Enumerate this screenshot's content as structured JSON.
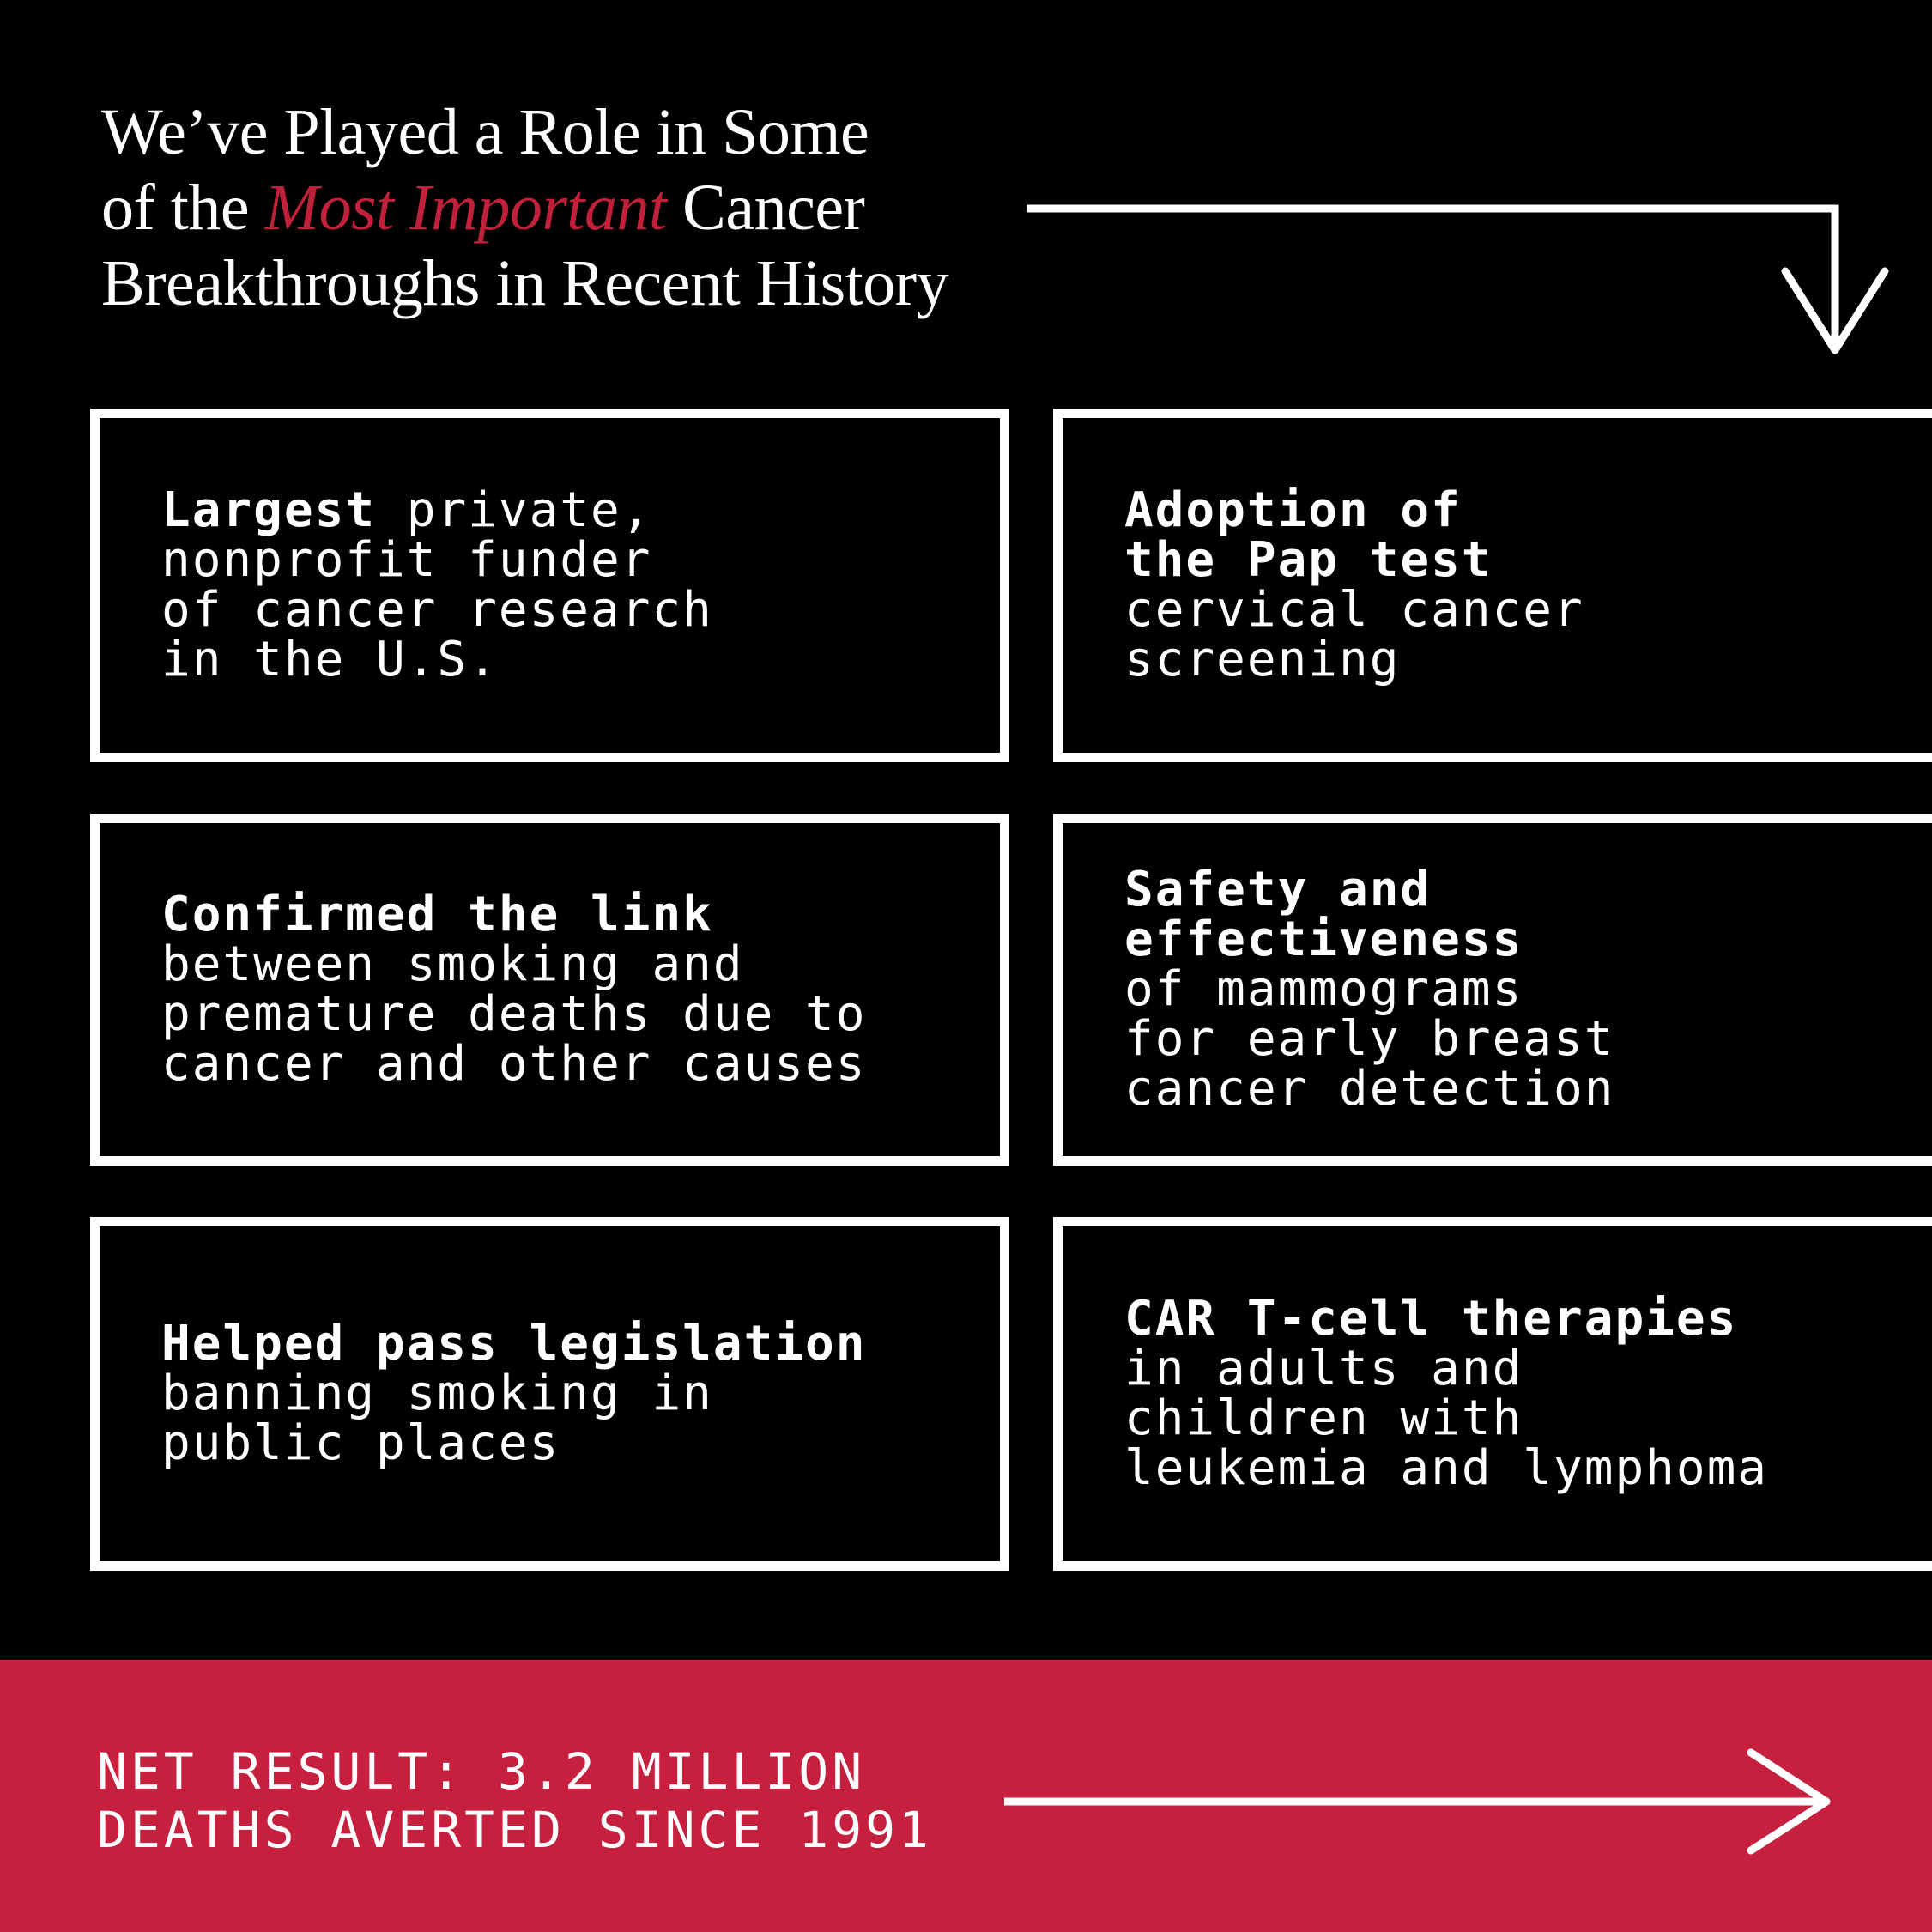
{
  "heading": {
    "line1": "We’ve Played a Role in Some",
    "line2_before": "of the ",
    "line2_accent": "Most Important",
    "line2_after": " Cancer",
    "line3": "Breakthroughs in Recent History"
  },
  "cards": [
    {
      "bold": [
        "Largest"
      ],
      "inline_light": " private,",
      "light": [
        "nonprofit funder",
        "of cancer research",
        "in the U.S."
      ]
    },
    {
      "bold": [
        "Adoption of",
        "the Pap test"
      ],
      "inline_light": "",
      "light": [
        "cervical cancer",
        "screening"
      ]
    },
    {
      "bold": [
        "Confirmed the link"
      ],
      "inline_light": "",
      "light": [
        "between smoking and",
        "premature deaths due to",
        "cancer and other causes"
      ]
    },
    {
      "bold": [
        "Safety and",
        "effectiveness"
      ],
      "inline_light": "",
      "light": [
        "of mammograms",
        "for early breast",
        "cancer detection"
      ]
    },
    {
      "bold": [
        "Helped pass legislation"
      ],
      "inline_light": "",
      "light": [
        "banning smoking in",
        "public places"
      ]
    },
    {
      "bold": [
        "CAR T-cell therapies"
      ],
      "inline_light": "",
      "light": [
        "in adults and",
        "children with",
        "leukemia and lymphoma"
      ]
    }
  ],
  "footer": {
    "line1": "NET RESULT: 3.2 MILLION",
    "line2": "DEATHS AVERTED SINCE 1991"
  },
  "colors": {
    "background": "#000000",
    "accent": "#c0203a",
    "banner": "#c7203e",
    "text": "#ffffff"
  },
  "icons": [
    "down-arrow-icon",
    "right-arrow-icon"
  ]
}
